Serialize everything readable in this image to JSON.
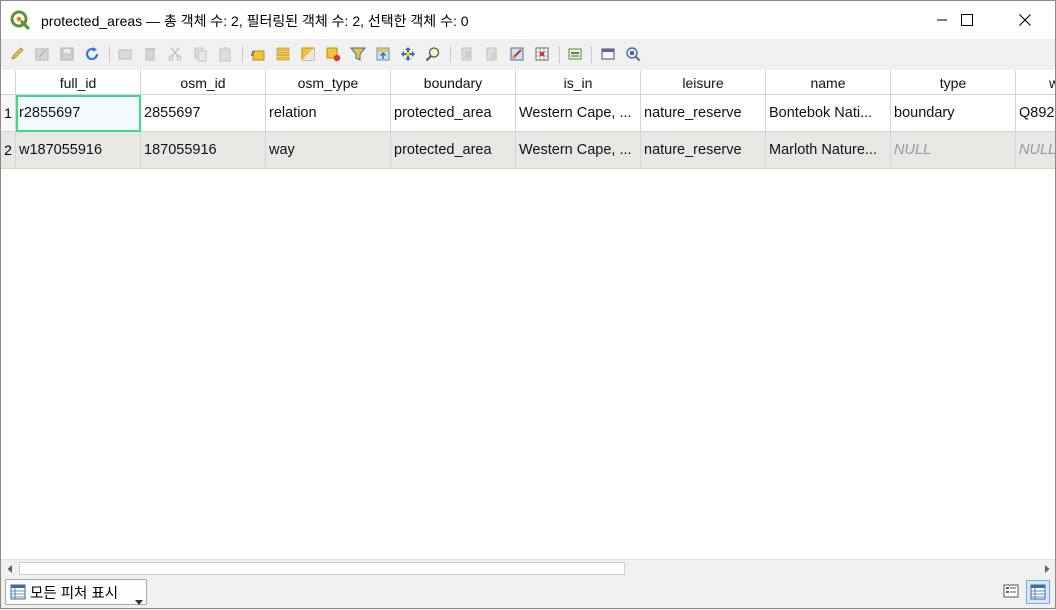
{
  "window": {
    "title": "protected_areas — 총 객체 수: 2, 필터링된 객체 수: 2, 선택한 객체 수: 0"
  },
  "toolbar": {
    "icons": [
      "toggle-edit-icon",
      "multi-edit-icon",
      "save-edits-icon",
      "reload-icon",
      "add-feature-icon",
      "delete-feature-icon",
      "cut-icon",
      "copy-icon",
      "paste-icon",
      "expression-select-icon",
      "select-all-icon",
      "invert-selection-icon",
      "deselect-icon",
      "filter-selected-icon",
      "move-selected-top-icon",
      "pan-to-selected-icon",
      "zoom-to-selected-icon",
      "new-field-icon",
      "delete-field-icon",
      "field-calculator-icon",
      "conditional-format-icon",
      "dock-icon",
      "actions-icon",
      "form-view-icon"
    ]
  },
  "table": {
    "columns": [
      "full_id",
      "osm_id",
      "osm_type",
      "boundary",
      "is_in",
      "leisure",
      "name",
      "type",
      "w"
    ],
    "rows": [
      {
        "num": "1",
        "cells": [
          "r2855697",
          "2855697",
          "relation",
          "protected_area",
          "Western Cape, ...",
          "nature_reserve",
          "Bontebok Nati...",
          "boundary",
          "Q892"
        ]
      },
      {
        "num": "2",
        "cells": [
          "w187055916",
          "187055916",
          "way",
          "protected_area",
          "Western Cape, ...",
          "nature_reserve",
          "Marloth Nature...",
          "NULL",
          "NULL"
        ]
      }
    ]
  },
  "statusbar": {
    "filter_label": "모든 피처 표시"
  },
  "colors": {
    "focus_outline": "#3ddc84",
    "alt_row": "#e9e7e3"
  }
}
